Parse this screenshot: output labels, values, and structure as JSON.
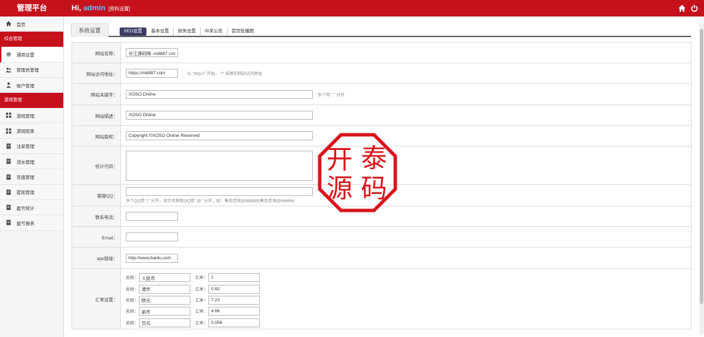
{
  "header": {
    "brand": "管理平台",
    "greeting": "Hi,",
    "username": "admin",
    "profile_link": "[资料设置]",
    "icons": [
      "home-icon",
      "power-icon"
    ]
  },
  "sidebar": {
    "home": {
      "label": "首页",
      "icon": "home-icon"
    },
    "group1": "综合管理",
    "group1_items": [
      {
        "label": "通用设置",
        "icon": "gear-icon",
        "active": true
      },
      {
        "label": "管理员管理",
        "icon": "users-icon"
      },
      {
        "label": "账户管理",
        "icon": "user-icon"
      }
    ],
    "group2": "游戏管理",
    "group2_items": [
      {
        "label": "游戏管理",
        "icon": "grid-icon"
      },
      {
        "label": "游戏赔率",
        "icon": "grid-icon"
      },
      {
        "label": "注单管理",
        "icon": "doc-icon"
      },
      {
        "label": "流水管理",
        "icon": "doc-icon"
      },
      {
        "label": "充值管理",
        "icon": "doc-icon"
      },
      {
        "label": "提现管理",
        "icon": "doc-icon"
      },
      {
        "label": "盈亏统计",
        "icon": "doc-icon"
      },
      {
        "label": "盈亏报表",
        "icon": "doc-icon"
      }
    ]
  },
  "page_tab": "系统设置",
  "tabs": [
    "SEO设置",
    "基本设置",
    "财务设置",
    "中奖公告",
    "首页轮播图"
  ],
  "form": {
    "site_name_label": "网站名称：",
    "site_name_value": "长江源码网--m8887.com",
    "site_url_label": "网站访问地址：",
    "site_url_value": "https://m8887.com",
    "site_url_hint": "以 \"http://\" 开始， \"/\" 结尾的网站访问地址",
    "keywords_label": "网站关键字：",
    "keywords_value": "XOSO Online",
    "keywords_hint": "多个用 \",\" 分开",
    "desc_label": "网站描述：",
    "desc_value": "XOSO Online",
    "copyright_label": "网站版权：",
    "copyright_value": "Copyright ©XOSO Online Reserved",
    "stats_label": "统计代码：",
    "stats_value": "",
    "qq_label": "客服QQ：",
    "qq_value": "",
    "qq_hint": "多个QQ用 \"|\" 分开，显示名称和QQ用 \"@\" 分开，如：售前咨询@888888|售后咨询@666666",
    "phone_label": "联系电话：",
    "phone_value": "",
    "email_label": "Email：",
    "email_value": "",
    "app_label": "app链接：",
    "app_value": "http://www.baidu.com",
    "rates_label": "汇率设置：",
    "rate_name_key": "名称：",
    "rate_value_key": "汇率：",
    "rates": [
      {
        "name": "人民币",
        "rate": "1"
      },
      {
        "name": "港币",
        "rate": "0.82"
      },
      {
        "name": "欧元",
        "rate": "7.23"
      },
      {
        "name": "新币",
        "rate": "4.66"
      },
      {
        "name": "日元",
        "rate": "0.056"
      }
    ]
  },
  "stamp": {
    "chars": [
      "开",
      "泰",
      "源",
      "码"
    ],
    "color": "#d8141c"
  },
  "colors": {
    "primary": "#c4111c",
    "active_tab": "#3c3c64"
  }
}
